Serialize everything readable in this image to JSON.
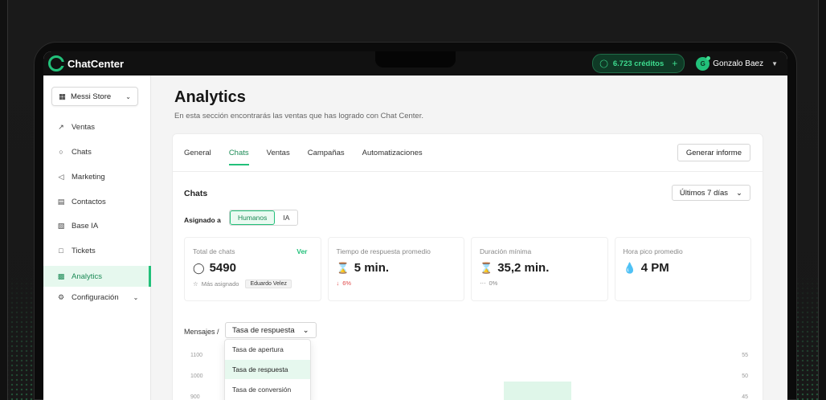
{
  "app": {
    "brand": "ChatCenter"
  },
  "topbar": {
    "credits_label": "6.723 créditos",
    "user_initial": "G",
    "user_name": "Gonzalo Baez"
  },
  "sidebar": {
    "store_name": "Messi Store",
    "items": [
      {
        "label": "Ventas",
        "icon": "trend-icon"
      },
      {
        "label": "Chats",
        "icon": "chat-icon"
      },
      {
        "label": "Marketing",
        "icon": "megaphone-icon"
      },
      {
        "label": "Contactos",
        "icon": "contact-card-icon"
      },
      {
        "label": "Base IA",
        "icon": "book-icon"
      },
      {
        "label": "Tickets",
        "icon": "ticket-icon"
      },
      {
        "label": "Analytics",
        "icon": "bar-chart-icon",
        "active": true
      },
      {
        "label": "Configuración",
        "icon": "gear-icon"
      }
    ]
  },
  "page": {
    "title": "Analytics",
    "subtitle": "En esta sección encontrarás las ventas que has logrado con Chat Center."
  },
  "tabs": [
    "General",
    "Chats",
    "Ventas",
    "Campañas",
    "Automatizaciones"
  ],
  "active_tab": "Chats",
  "report_button": "Generar informe",
  "section": {
    "title": "Chats",
    "range": "Últimos 7 días",
    "assigned_label": "Asignado a",
    "assigned_options": [
      "Humanos",
      "IA"
    ],
    "assigned_selected": "Humanos"
  },
  "kpis": [
    {
      "label": "Total de chats",
      "link": "Ver",
      "value": "5490",
      "foot_label": "Más asignado",
      "foot_tag": "Eduardo Velez"
    },
    {
      "label": "Tiempo de respuesta promedio",
      "value": "5 min.",
      "foot_label": "6%",
      "trend": "down"
    },
    {
      "label": "Duración mínima",
      "value": "35,2 min.",
      "foot_label": "0%"
    },
    {
      "label": "Hora pico promedio",
      "value": "4 PM"
    }
  ],
  "messages": {
    "label": "Mensajes /",
    "selected": "Tasa de respuesta",
    "options": [
      "Tasa de apertura",
      "Tasa de respuesta",
      "Tasa de conversión"
    ]
  },
  "chart_axis": {
    "left_ticks": [
      "1100",
      "1000",
      "900"
    ],
    "right_ticks": [
      "55",
      "50",
      "45"
    ]
  },
  "colors": {
    "accent": "#22c07a",
    "accent_dark": "#1b8a55",
    "negative": "#e04b4b"
  }
}
